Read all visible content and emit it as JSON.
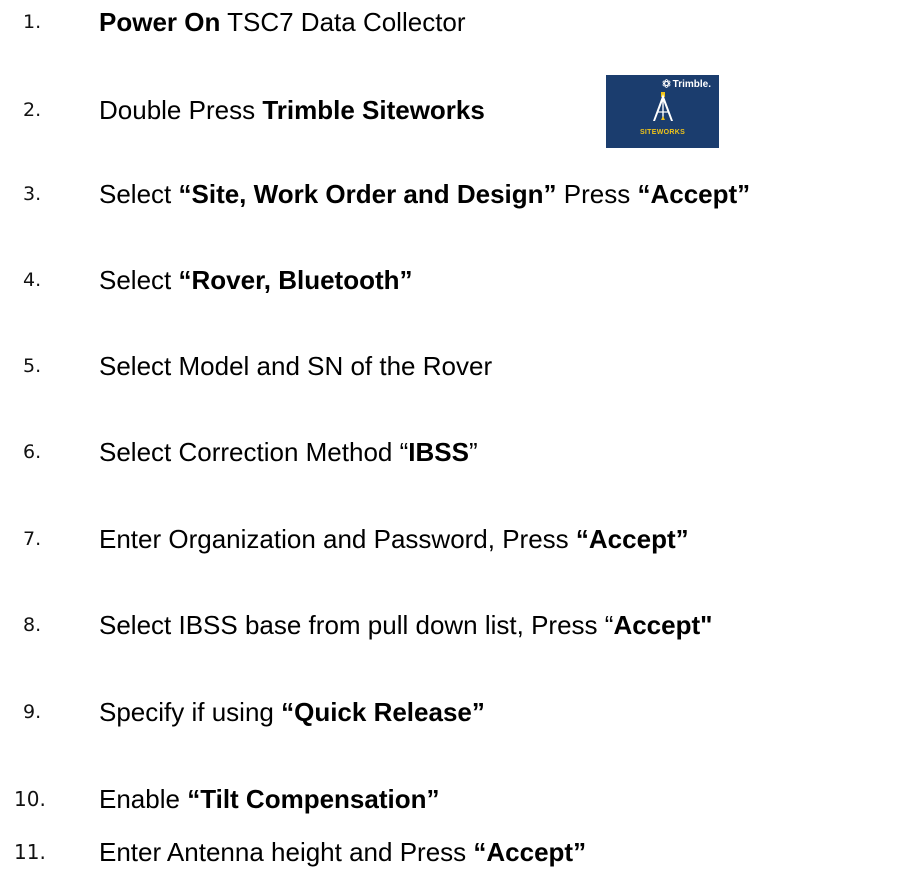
{
  "steps": [
    {
      "num": "1.",
      "parts": [
        {
          "b": "Power On"
        },
        {
          "t": " TSC7 Data Collector"
        }
      ]
    },
    {
      "num": "2.",
      "parts": [
        {
          "t": "Double Press "
        },
        {
          "b": "Trimble Siteworks"
        }
      ]
    },
    {
      "num": "3.",
      "parts": [
        {
          "t": "Select "
        },
        {
          "b": "“Site, Work Order and Design”"
        },
        {
          "t": " Press "
        },
        {
          "b": "“Accept”"
        }
      ]
    },
    {
      "num": "4.",
      "parts": [
        {
          "t": "Select "
        },
        {
          "b": "“Rover, Bluetooth”"
        }
      ]
    },
    {
      "num": "5.",
      "parts": [
        {
          "t": "Select Model and SN of the Rover"
        }
      ]
    },
    {
      "num": "6.",
      "parts": [
        {
          "t": "Select Correction Method “"
        },
        {
          "b": "IBSS"
        },
        {
          "t": "”"
        }
      ]
    },
    {
      "num": "7.",
      "parts": [
        {
          "t": "Enter Organization and Password, Press "
        },
        {
          "b": "“Accept”"
        }
      ]
    },
    {
      "num": "8.",
      "parts": [
        {
          "t": "Select IBSS base from pull down list, Press “"
        },
        {
          "b": "Accept\""
        }
      ]
    },
    {
      "num": "9.",
      "parts": [
        {
          "t": "Specify if using "
        },
        {
          "b": "“Quick Release”"
        }
      ]
    },
    {
      "num": "10.",
      "parts": [
        {
          "t": "Enable "
        },
        {
          "b": "“Tilt Compensation”"
        }
      ]
    },
    {
      "num": "11.",
      "parts": [
        {
          "t": "Enter Antenna height and Press "
        },
        {
          "b": "“Accept”"
        }
      ]
    }
  ],
  "logo": {
    "brand": "Trimble.",
    "product": "SITEWORKS",
    "icon": "trimble-siteworks-tripod-icon",
    "background_color": "#1b3d6e",
    "product_color": "#f0c419"
  }
}
